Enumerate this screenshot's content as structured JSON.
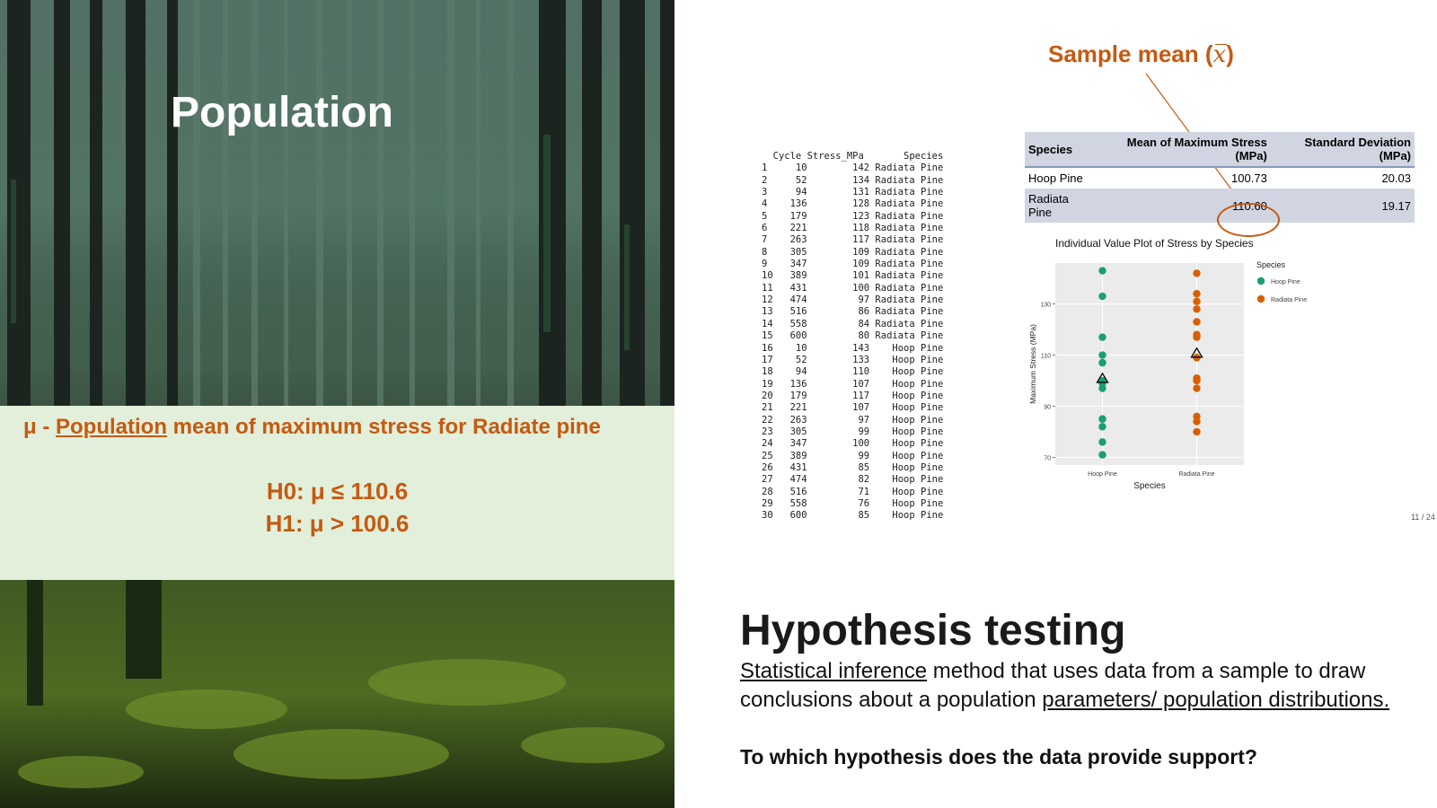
{
  "left_panel": {
    "population_title": "Population",
    "mu_symbol": "μ -",
    "mu_underlined": "Population",
    "mu_rest": "mean of maximum stress for Radiate pine",
    "h0": "H0: μ ≤ 110.6",
    "h1": "H1: μ > 100.6"
  },
  "sample_mean": {
    "label": "Sample mean (",
    "symbol": "x̅",
    "close": ")"
  },
  "data_table": {
    "header": "  Cycle Stress_MPa       Species",
    "rows": [
      "1     10        142 Radiata Pine",
      "2     52        134 Radiata Pine",
      "3     94        131 Radiata Pine",
      "4    136        128 Radiata Pine",
      "5    179        123 Radiata Pine",
      "6    221        118 Radiata Pine",
      "7    263        117 Radiata Pine",
      "8    305        109 Radiata Pine",
      "9    347        109 Radiata Pine",
      "10   389        101 Radiata Pine",
      "11   431        100 Radiata Pine",
      "12   474         97 Radiata Pine",
      "13   516         86 Radiata Pine",
      "14   558         84 Radiata Pine",
      "15   600         80 Radiata Pine",
      "16    10        143    Hoop Pine",
      "17    52        133    Hoop Pine",
      "18    94        110    Hoop Pine",
      "19   136        107    Hoop Pine",
      "20   179        117    Hoop Pine",
      "21   221        107    Hoop Pine",
      "22   263         97    Hoop Pine",
      "23   305         99    Hoop Pine",
      "24   347        100    Hoop Pine",
      "25   389         99    Hoop Pine",
      "26   431         85    Hoop Pine",
      "27   474         82    Hoop Pine",
      "28   516         71    Hoop Pine",
      "29   558         76    Hoop Pine",
      "30   600         85    Hoop Pine"
    ]
  },
  "stats_table": {
    "headers": [
      "Species",
      "Mean of Maximum Stress (MPa)",
      "Standard Deviation (MPa)"
    ],
    "rows": [
      [
        "Hoop Pine",
        "100.73",
        "20.03"
      ],
      [
        "Radiata Pine",
        "110.60",
        "19.17"
      ]
    ]
  },
  "chart_data": {
    "type": "scatter",
    "title": "Individual Value Plot of Stress by Species",
    "xlabel": "Species",
    "ylabel": "Maximum Stress (MPa)",
    "categories": [
      "Hoop Pine",
      "Radiata Pine"
    ],
    "ylim": [
      67,
      146
    ],
    "yticks": [
      70,
      90,
      110,
      130
    ],
    "legend_title": "Species",
    "legend_position": "right",
    "grid": true,
    "series": [
      {
        "name": "Hoop Pine",
        "color": "#1b9e77",
        "category": "Hoop Pine",
        "values": [
          143,
          133,
          117,
          110,
          107,
          107,
          100,
          99,
          99,
          97,
          85,
          85,
          82,
          76,
          71
        ],
        "mean": 100.73
      },
      {
        "name": "Radiata Pine",
        "color": "#d95f02",
        "category": "Radiata Pine",
        "values": [
          142,
          134,
          131,
          128,
          123,
          118,
          117,
          109,
          109,
          101,
          100,
          97,
          86,
          84,
          80
        ],
        "mean": 110.6
      }
    ]
  },
  "page_number": "11 / 24",
  "hypothesis": {
    "title": "Hypothesis testing",
    "desc_u1": "Statistical inference",
    "desc_mid": " method that uses data from a sample to draw conclusions about a population ",
    "desc_u2": "parameters/ population distributions.",
    "question": "To which hypothesis does the data provide support?"
  }
}
